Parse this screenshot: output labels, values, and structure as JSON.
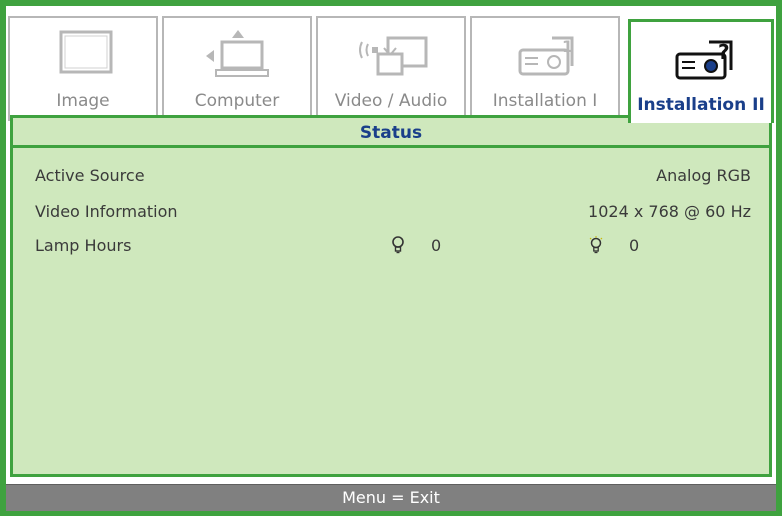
{
  "tabs": [
    {
      "label": "Image",
      "icon": "display-icon",
      "active": false
    },
    {
      "label": "Computer",
      "icon": "computer-icon",
      "active": false
    },
    {
      "label": "Video / Audio",
      "icon": "video-audio-icon",
      "active": false
    },
    {
      "label": "Installation I",
      "icon": "projector-icon",
      "active": false
    },
    {
      "label": "Installation II",
      "icon": "projector-help-icon",
      "active": true
    }
  ],
  "status": {
    "title": "Status",
    "rows": [
      {
        "label": "Active Source",
        "value": "Analog RGB"
      },
      {
        "label": "Video Information",
        "value": "1024 x 768 @ 60 Hz"
      }
    ],
    "lamp": {
      "label": "Lamp Hours",
      "normal_hours": "0",
      "eco_hours": "0"
    }
  },
  "footer": {
    "text": "Menu = Exit"
  },
  "colors": {
    "accent_green": "#3fa23f",
    "panel_bg": "#cfe8bd",
    "active_text": "#1a3f8a",
    "footer_bg": "#808080"
  }
}
